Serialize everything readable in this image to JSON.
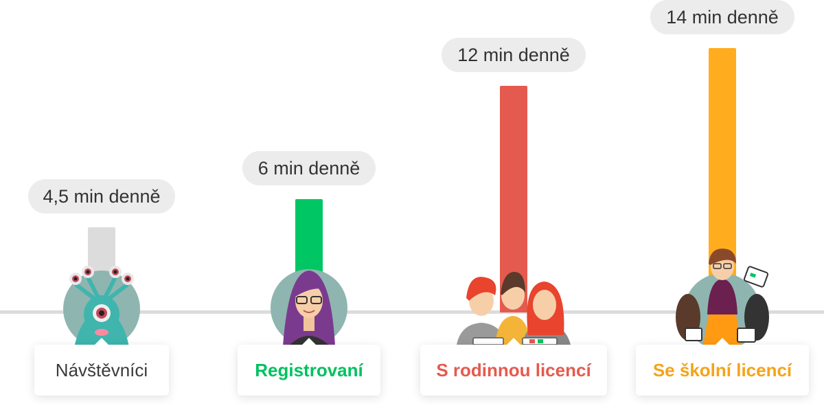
{
  "chart_data": {
    "type": "bar",
    "categories": [
      "Návštěvníci",
      "Registrovaní",
      "S rodinnou licencí",
      "Se školní licencí"
    ],
    "values": [
      4.5,
      6,
      12,
      14
    ],
    "value_labels": [
      "4,5 min denně",
      "6 min denně",
      "12 min denně",
      "14 min denně"
    ],
    "colors": [
      "#dcdcdc",
      "#00c764",
      "#e55a4e",
      "#ffad1e"
    ],
    "label_colors": [
      "#3a3a3a",
      "#00c15f",
      "#e55a4e",
      "#f5a31a"
    ],
    "label_weights": [
      "normal",
      "bold",
      "bold",
      "bold"
    ],
    "icons": [
      "monster-avatar-icon",
      "teacher-girl-avatar-icon",
      "family-group-avatar-icon",
      "school-teacher-avatar-icon"
    ],
    "title": "",
    "xlabel": "",
    "ylabel": "",
    "ylim": [
      0,
      14
    ],
    "grid": false,
    "legend": "none"
  }
}
